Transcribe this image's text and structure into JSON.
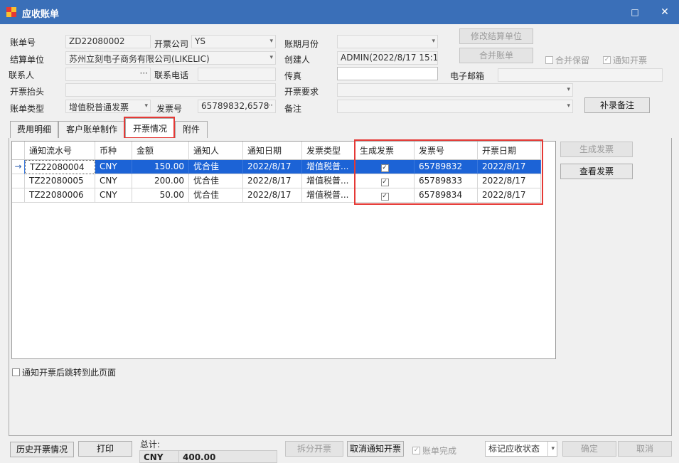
{
  "window": {
    "title": "应收账单",
    "minimize": "□",
    "close": "✕"
  },
  "form": {
    "bill_no_label": "账单号",
    "bill_no": "ZD22080002",
    "invoice_company_label": "开票公司",
    "invoice_company": "YS",
    "period_label": "账期月份",
    "period": "",
    "settle_unit_label": "结算单位",
    "settle_unit": "苏州立刻电子商务有限公司(LIKELIC)",
    "creator_label": "创建人",
    "creator": "ADMIN(2022/8/17 15:1",
    "contact_label": "联系人",
    "contact": "",
    "phone_label": "联系电话",
    "phone": "",
    "fax_label": "传真",
    "fax": "",
    "email_label": "电子邮箱",
    "email": "",
    "invoice_title_label": "开票抬头",
    "invoice_title": "",
    "invoice_req_label": "开票要求",
    "invoice_req": "",
    "bill_type_label": "账单类型",
    "bill_type": "增值税普通发票",
    "invoice_no_label": "发票号",
    "invoice_no": "65789832,6578",
    "remark_label": "备注",
    "remark": "",
    "ellipsis": "···"
  },
  "buttons": {
    "modify_settle": "修改结算单位",
    "merge_bill": "合并账单",
    "add_remark": "补录备注",
    "gen_invoice": "生成发票",
    "view_invoice": "查看发票",
    "history": "历史开票情况",
    "print": "打印",
    "split": "拆分开票",
    "cancel_notice": "取消通知开票",
    "mark_status": "标记应收状态",
    "confirm": "确定",
    "cancel": "取消"
  },
  "checks": {
    "merge_keep": "合并保留",
    "notify_invoice": "通知开票",
    "jump_after": "通知开票后跳转到此页面",
    "bill_done": "账单完成"
  },
  "tabs": [
    "费用明细",
    "客户账单制作",
    "开票情况",
    "附件"
  ],
  "grid": {
    "columns": [
      "通知流水号",
      "币种",
      "金额",
      "通知人",
      "通知日期",
      "发票类型",
      "生成发票",
      "发票号",
      "开票日期"
    ],
    "rows": [
      {
        "no": "TZ22080004",
        "cur": "CNY",
        "amt": "150.00",
        "person": "优合佳",
        "date": "2022/8/17",
        "type": "增值税普...",
        "gen": "✓",
        "inv": "65789832",
        "inv_date": "2022/8/17"
      },
      {
        "no": "TZ22080005",
        "cur": "CNY",
        "amt": "200.00",
        "person": "优合佳",
        "date": "2022/8/17",
        "type": "增值税普...",
        "gen": "✓",
        "inv": "65789833",
        "inv_date": "2022/8/17"
      },
      {
        "no": "TZ22080006",
        "cur": "CNY",
        "amt": "50.00",
        "person": "优合佳",
        "date": "2022/8/17",
        "type": "增值税普...",
        "gen": "✓",
        "inv": "65789834",
        "inv_date": "2022/8/17"
      }
    ],
    "row_indicator": "→"
  },
  "totals": {
    "label": "总计:",
    "currency": "CNY",
    "amount": "400.00"
  },
  "colors": {
    "titlebar": "#3a6fb8",
    "selection": "#1c63d6",
    "highlight": "#e53935"
  }
}
